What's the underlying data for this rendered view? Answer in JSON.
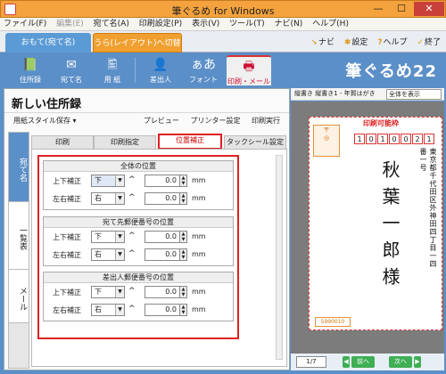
{
  "window": {
    "title": "筆ぐるめ for Windows",
    "min": "—",
    "max": "☐",
    "close": "✕"
  },
  "menu": [
    {
      "label": "ファイル(F)",
      "disabled": false
    },
    {
      "label": "編集(E)",
      "disabled": true
    },
    {
      "label": "宛て名(A)",
      "disabled": false
    },
    {
      "label": "印刷設定(P)",
      "disabled": false
    },
    {
      "label": "表示(V)",
      "disabled": false
    },
    {
      "label": "ツール(T)",
      "disabled": false
    },
    {
      "label": "ナビ(N)",
      "disabled": false
    },
    {
      "label": "ヘルプ(H)",
      "disabled": false
    }
  ],
  "modebar": {
    "front_tab": "おもて(宛て名)",
    "switch_tab": "うら(レイアウト)へ切替",
    "links": [
      "ナビ",
      "設定",
      "ヘルプ",
      "終了"
    ]
  },
  "toolbar": {
    "buttons": [
      {
        "label": "住所録",
        "glyph": "📗"
      },
      {
        "label": "宛て名",
        "glyph": "✉"
      },
      {
        "label": "用 紙",
        "glyph": "🖺"
      },
      {
        "label": "差出人",
        "glyph": "👤"
      },
      {
        "label": "フォント",
        "glyph": "ぁあ"
      },
      {
        "label": "印刷・メール",
        "glyph": "🖶"
      }
    ],
    "brand": "筆ぐるめ22"
  },
  "left": {
    "title": "新しい住所録",
    "style_save": "用紙スタイル保存",
    "actions": [
      "プレビュー",
      "プリンター設定",
      "印刷実行"
    ],
    "side_tabs": [
      "宛て名",
      "一覧表",
      "メール",
      ""
    ],
    "inner_tabs": [
      "印刷",
      "印刷指定",
      "位置補正",
      "タックシール設定"
    ],
    "groups": [
      {
        "title": "全体の位置",
        "rows": [
          {
            "label": "上下補正",
            "select": "下",
            "value": "0.0",
            "unit": "mm"
          },
          {
            "label": "左右補正",
            "select": "右",
            "value": "0.0",
            "unit": "mm"
          }
        ]
      },
      {
        "title": "宛て先郵便番号の位置",
        "rows": [
          {
            "label": "上下補正",
            "select": "下",
            "value": "0.0",
            "unit": "mm"
          },
          {
            "label": "左右補正",
            "select": "右",
            "value": "0.0",
            "unit": "mm"
          }
        ]
      },
      {
        "title": "差出人郵便番号の位置",
        "rows": [
          {
            "label": "上下補正",
            "select": "下",
            "value": "0.0",
            "unit": "mm"
          },
          {
            "label": "左右補正",
            "select": "右",
            "value": "0.0",
            "unit": "mm"
          }
        ]
      }
    ]
  },
  "preview": {
    "info": "縦書き 縦書き1 - 年賀はがき",
    "view_select": "全体を表示",
    "printable": "印刷可能枠",
    "zip": [
      "1",
      "0",
      "1",
      "0",
      "0",
      "2",
      "1"
    ],
    "address": "東京都千代田区外神田四丁目一四番一号",
    "name": "秋葉一郎様",
    "sender_zip": "5990010",
    "page": "1/7",
    "prev": "前へ",
    "next": "次へ"
  }
}
